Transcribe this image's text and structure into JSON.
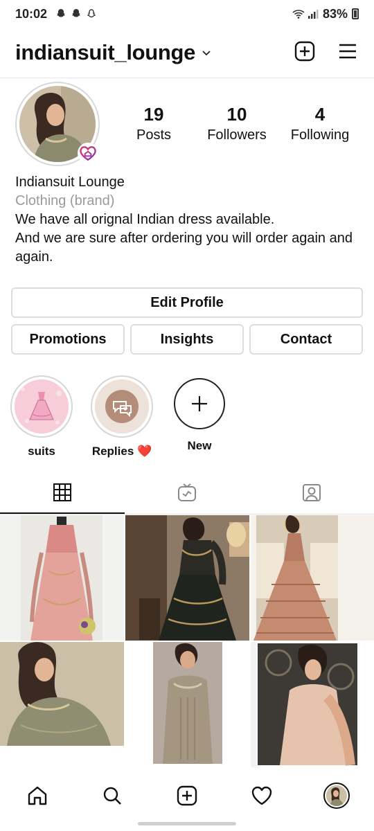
{
  "status_bar": {
    "time": "10:02",
    "battery": "83%",
    "left_icons": [
      "snapchat-icon",
      "snapchat-icon",
      "ghost-icon"
    ],
    "right_icons": [
      "wifi-icon",
      "signal-icon",
      "battery-icon"
    ]
  },
  "header": {
    "username": "indiansuit_lounge",
    "icons": [
      "chevron-down-icon",
      "new-post-icon",
      "menu-icon"
    ]
  },
  "profile": {
    "stats": [
      {
        "num": "19",
        "label": "Posts"
      },
      {
        "num": "10",
        "label": "Followers"
      },
      {
        "num": "4",
        "label": "Following"
      }
    ],
    "name": "Indiansuit Lounge",
    "category": "Clothing (brand)",
    "bio": "We have all orignal Indian dress available.\nAnd we are sure after ordering you will order again and again."
  },
  "buttons": {
    "edit_profile": "Edit Profile",
    "promotions": "Promotions",
    "insights": "Insights",
    "contact": "Contact"
  },
  "highlights": [
    {
      "label": "suits"
    },
    {
      "label": "Replies ❤️"
    },
    {
      "label": "New"
    }
  ],
  "tabs": [
    "grid-icon",
    "igtv-icon",
    "tagged-icon"
  ],
  "bottom_nav": [
    "home-icon",
    "search-icon",
    "add-post-icon",
    "activity-heart-icon",
    "profile-avatar"
  ],
  "colors": {
    "category_gray": "#9a9a9a",
    "border": "#dcdcdc",
    "badge_gradient_start": "#e1306c",
    "badge_gradient_end": "#833ab4"
  }
}
